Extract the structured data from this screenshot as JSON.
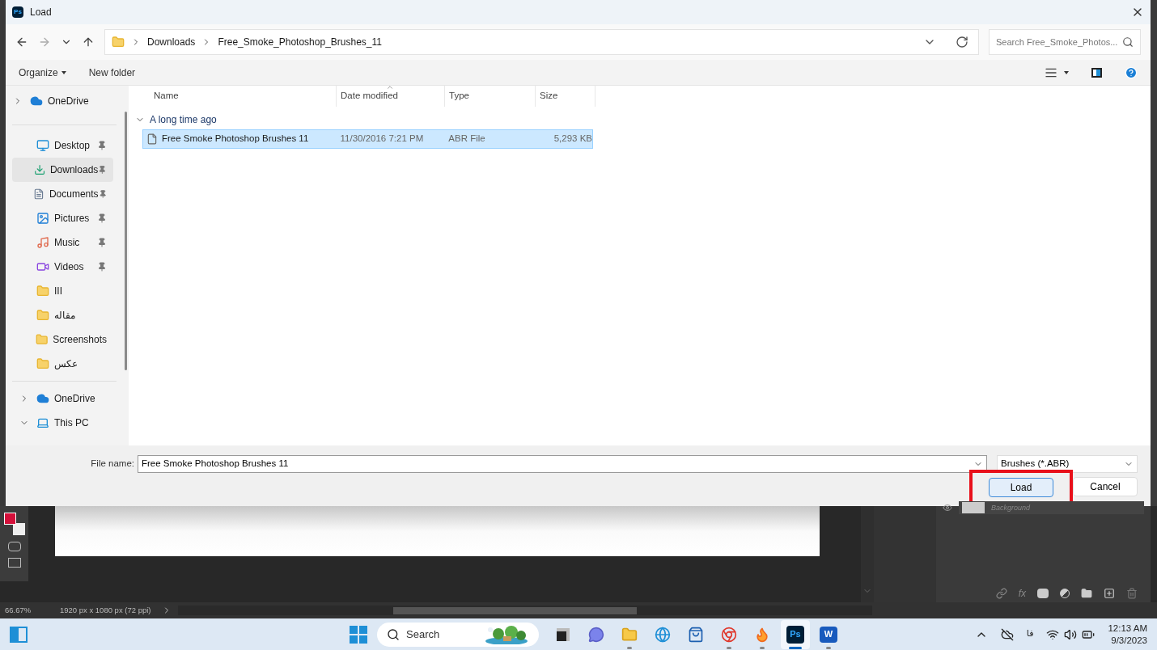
{
  "dialog": {
    "app_badge": "Ps",
    "title": "Load",
    "breadcrumb": [
      "Downloads",
      "Free_Smoke_Photoshop_Brushes_11"
    ],
    "search": {
      "placeholder": "Search Free_Smoke_Photos..."
    },
    "toolbar": [
      {
        "label": "Organize",
        "menu": true
      },
      {
        "label": "New folder",
        "menu": false
      }
    ],
    "nav": [
      [
        {
          "label": "OneDrive",
          "kind": "cloud",
          "expandable": true,
          "expanded": false,
          "pinned": false,
          "selected": false
        }
      ],
      [
        {
          "label": "Desktop",
          "kind": "desktop",
          "pinned": true,
          "selected": false
        },
        {
          "label": "Downloads",
          "kind": "download",
          "pinned": true,
          "selected": true
        },
        {
          "label": "Documents",
          "kind": "documents",
          "pinned": true,
          "selected": false
        },
        {
          "label": "Pictures",
          "kind": "pictures",
          "pinned": true,
          "selected": false
        },
        {
          "label": "Music",
          "kind": "music",
          "pinned": true,
          "selected": false
        },
        {
          "label": "Videos",
          "kind": "videos",
          "pinned": true,
          "selected": false
        },
        {
          "label": "III",
          "kind": "folder",
          "pinned": false,
          "selected": false
        },
        {
          "label": "مقاله",
          "kind": "folder",
          "pinned": false,
          "selected": false
        },
        {
          "label": "Screenshots",
          "kind": "folder",
          "pinned": false,
          "selected": false
        },
        {
          "label": "عکس",
          "kind": "folder",
          "pinned": false,
          "selected": false
        }
      ],
      [
        {
          "label": "OneDrive",
          "kind": "cloud",
          "expandable": true,
          "expanded": false,
          "pinned": false,
          "selected": false
        },
        {
          "label": "This PC",
          "kind": "pc",
          "expandable": true,
          "expanded": true,
          "pinned": false,
          "selected": false
        }
      ]
    ],
    "columns": [
      "Name",
      "Date modified",
      "Type",
      "Size"
    ],
    "group": {
      "label": "A long time ago",
      "expanded": true
    },
    "files": [
      {
        "name": "Free Smoke Photoshop Brushes 11",
        "date": "11/30/2016 7:21 PM",
        "type": "ABR File",
        "size": "5,293 KB",
        "selected": true
      }
    ],
    "file_name": {
      "label": "File name:",
      "value": "Free Smoke Photoshop Brushes 11"
    },
    "filter": "Brushes (*.ABR)",
    "buttons": [
      {
        "label": "Load",
        "kind": "primary",
        "highlighted": true
      },
      {
        "label": "Cancel",
        "kind": "secondary",
        "highlighted": false
      }
    ]
  },
  "photoshop": {
    "layer": "Background",
    "layer_tools": [
      "fx"
    ],
    "zoom": "66.67%",
    "doc_info": "1920 px x 1080 px (72 ppi)"
  },
  "taskbar": {
    "search": "Search",
    "apps": [
      {
        "kind": "files",
        "open": false,
        "active": false
      },
      {
        "kind": "chat",
        "open": false,
        "active": false
      },
      {
        "kind": "explorer",
        "open": true,
        "active": false
      },
      {
        "kind": "edge",
        "open": false,
        "active": false
      },
      {
        "kind": "store",
        "open": false,
        "active": false
      },
      {
        "kind": "chrome",
        "open": true,
        "active": false
      },
      {
        "kind": "firefox",
        "open": true,
        "active": false
      },
      {
        "kind": "photoshop",
        "badge": "Ps",
        "open": true,
        "active": true
      },
      {
        "kind": "word",
        "badge": "W",
        "open": true,
        "active": false
      }
    ],
    "language": "فا",
    "time": "12:13 AM",
    "date": "9/3/2023"
  }
}
